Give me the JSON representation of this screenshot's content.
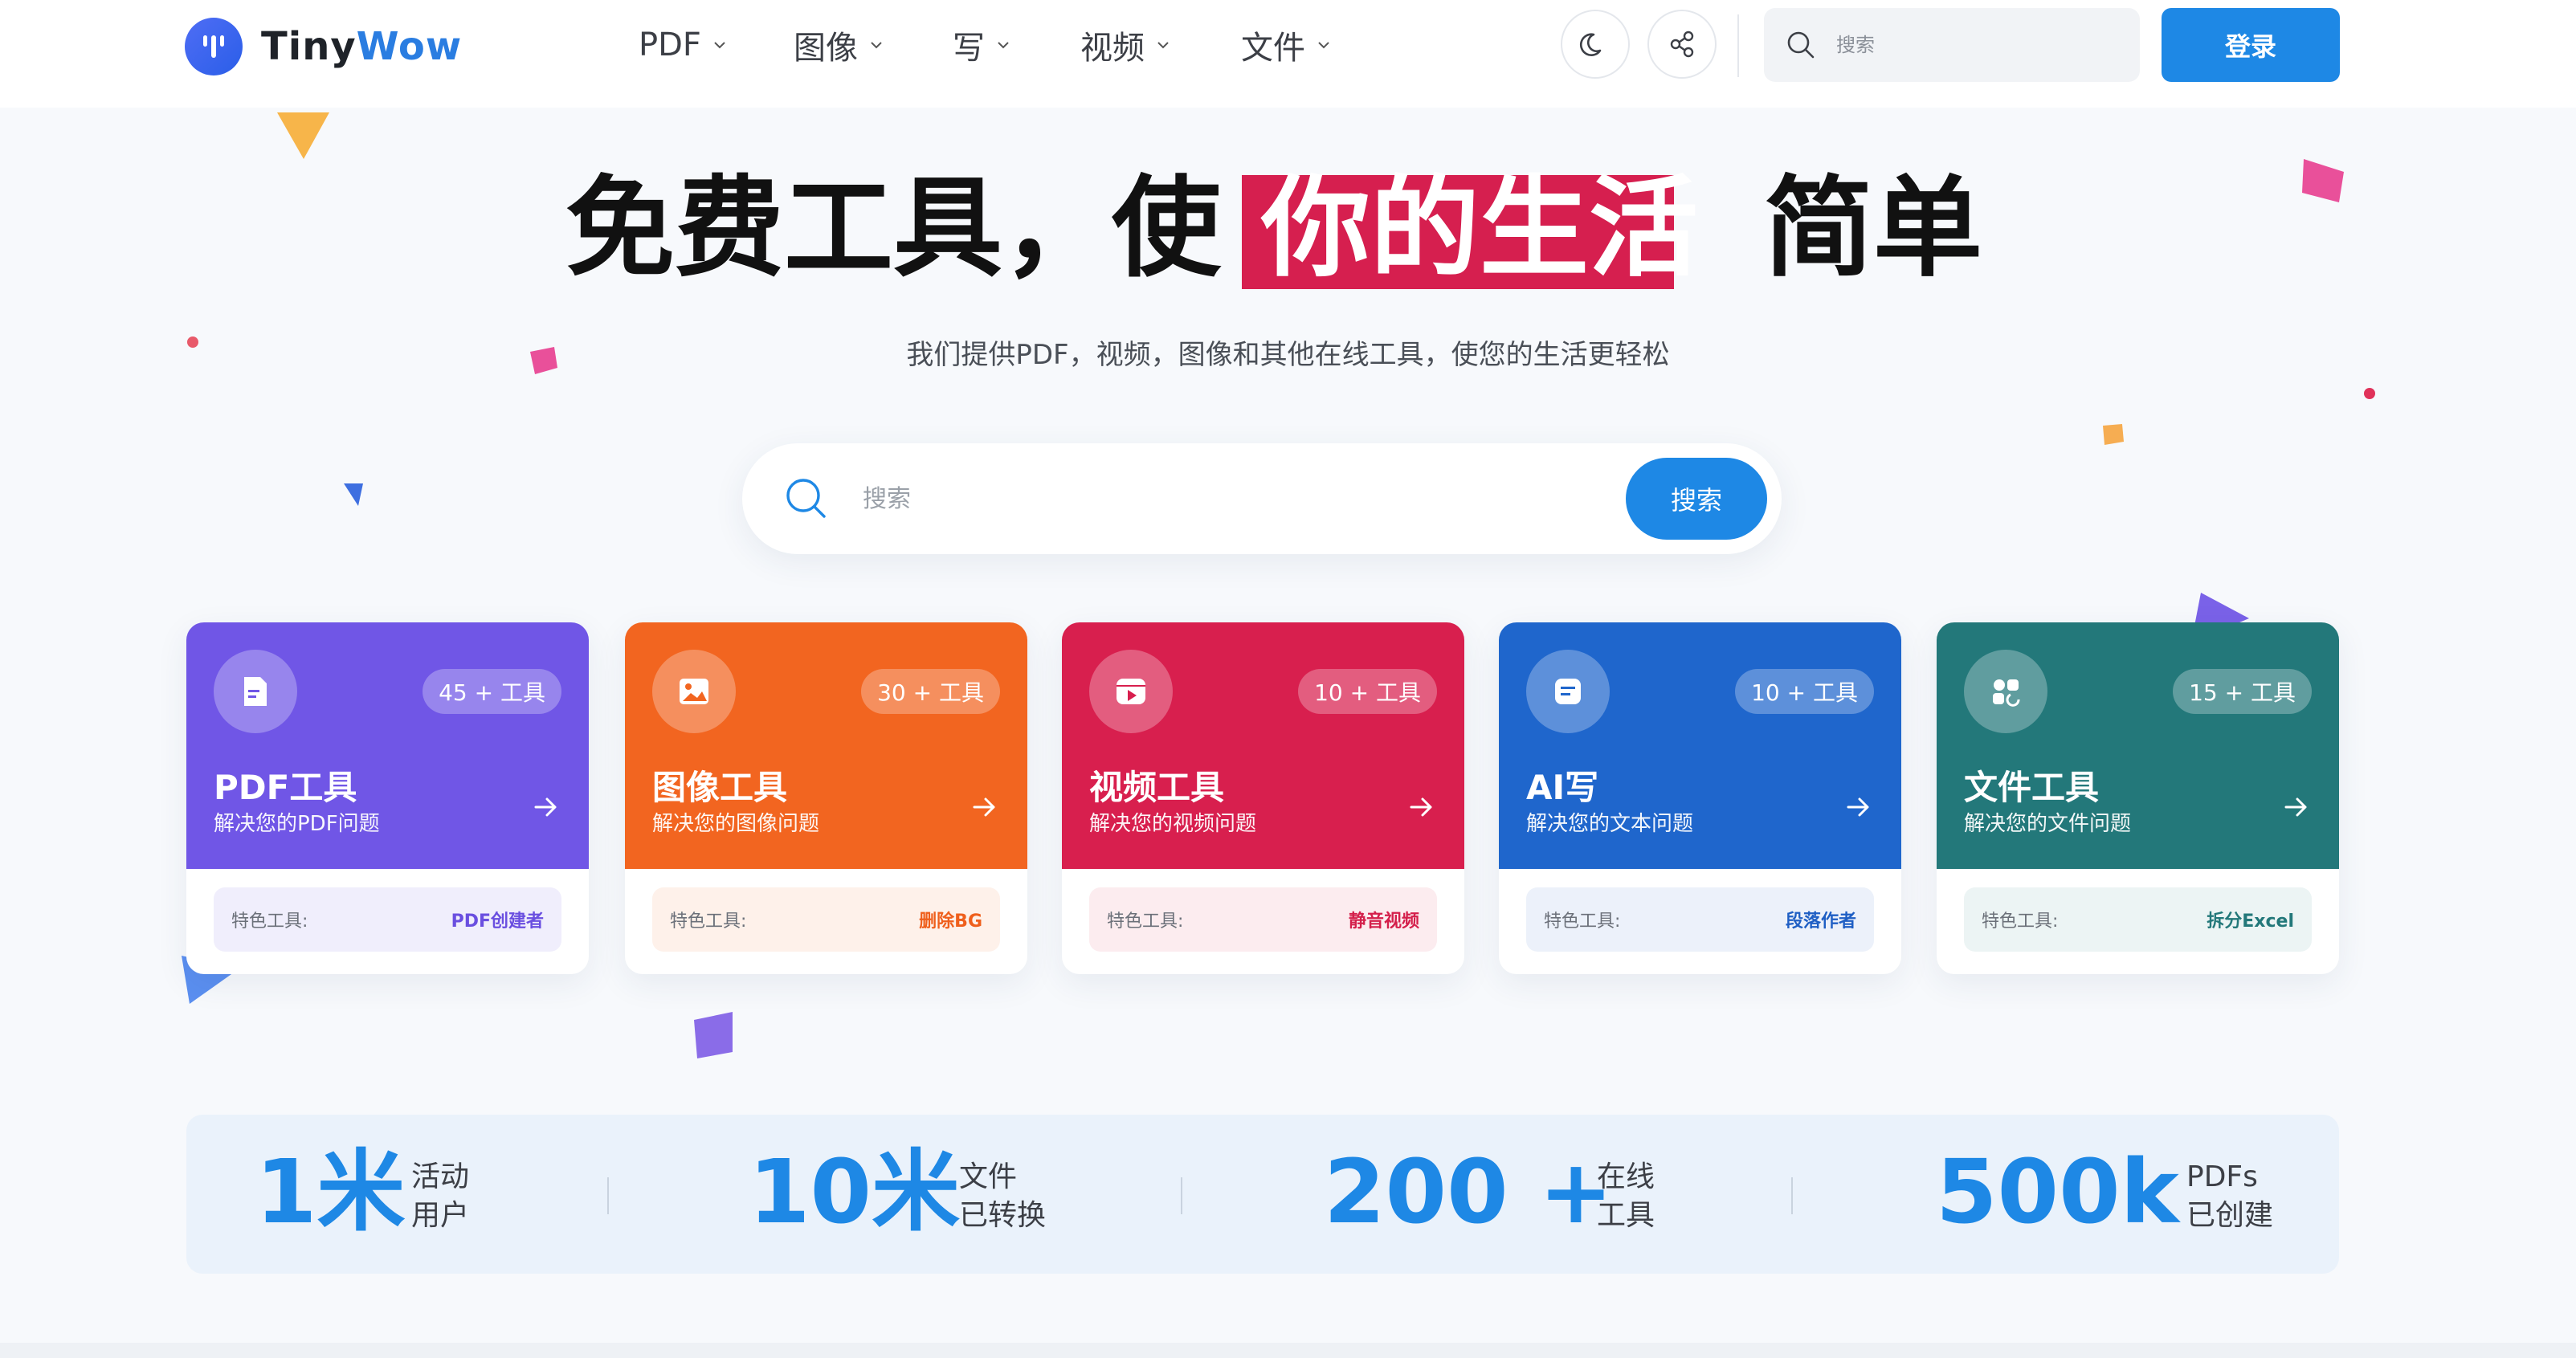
{
  "brand": {
    "name_part1": "Tiny",
    "name_part2": "Wow"
  },
  "nav": [
    {
      "label": "PDF"
    },
    {
      "label": "图像"
    },
    {
      "label": "写"
    },
    {
      "label": "视频"
    },
    {
      "label": "文件"
    }
  ],
  "header": {
    "search_placeholder": "搜索",
    "login_label": "登录"
  },
  "hero": {
    "part1": "免费工具，使",
    "highlight": "你的生活",
    "part2": "简单",
    "subtitle": "我们提供PDF，视频，图像和其他在线工具，使您的生活更轻松"
  },
  "search": {
    "placeholder": "搜索",
    "button": "搜索"
  },
  "cards": [
    {
      "title": "PDF工具",
      "subtitle": "解决您的PDF问题",
      "badge": "45 + 工具",
      "feature_label": "特色工具:",
      "feature_value": "PDF创建者",
      "color": "#7056e6",
      "feature_bg": "#f0eefc",
      "feature_color": "#6a4fe0"
    },
    {
      "title": "图像工具",
      "subtitle": "解决您的图像问题",
      "badge": "30 + 工具",
      "feature_label": "特色工具:",
      "feature_value": "删除BG",
      "color": "#f26520",
      "feature_bg": "#fef1ea",
      "feature_color": "#ef5f1c"
    },
    {
      "title": "视频工具",
      "subtitle": "解决您的视频问题",
      "badge": "10 + 工具",
      "feature_label": "特色工具:",
      "feature_value": "静音视频",
      "color": "#d81f4e",
      "feature_bg": "#fcecef",
      "feature_color": "#d41f4b"
    },
    {
      "title": "AI写",
      "subtitle": "解决您的文本问题",
      "badge": "10 + 工具",
      "feature_label": "特色工具:",
      "feature_value": "段落作者",
      "color": "#1f66cc",
      "feature_bg": "#ecf1fa",
      "feature_color": "#1f5fc4"
    },
    {
      "title": "文件工具",
      "subtitle": "解决您的文件问题",
      "badge": "15 + 工具",
      "feature_label": "特色工具:",
      "feature_value": "拆分Excel",
      "color": "#23787a",
      "feature_bg": "#ecf4f4",
      "feature_color": "#23787a"
    }
  ],
  "stats": [
    {
      "value": "1米",
      "label_line1": "活动",
      "label_line2": "用户"
    },
    {
      "value": "10米",
      "label_line1": "文件",
      "label_line2": "已转换"
    },
    {
      "value": "200 +",
      "label_line1": "在线",
      "label_line2": "工具"
    },
    {
      "value": "500k",
      "label_line1": "PDFs",
      "label_line2": "已创建"
    }
  ],
  "icons": {
    "brand": "tinywow-logo-icon",
    "theme": "moon-icon",
    "share": "share-icon",
    "search": "search-icon",
    "card_icons": [
      "pdf-file-icon",
      "image-icon",
      "video-icon",
      "ai-write-icon",
      "file-tools-icon"
    ],
    "card_arrow": "arrow-right-icon"
  }
}
